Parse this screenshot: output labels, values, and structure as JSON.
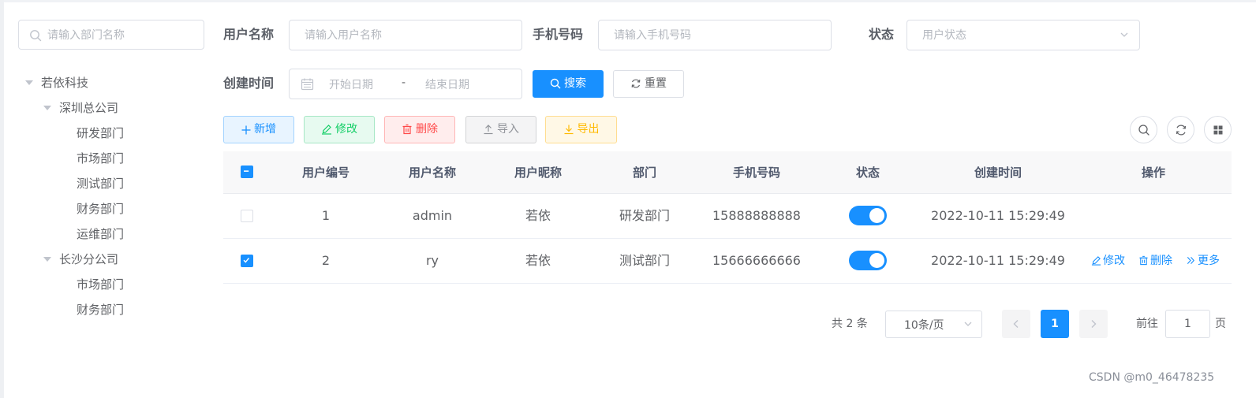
{
  "sidebar": {
    "search_placeholder": "请输入部门名称",
    "tree": [
      {
        "label": "若依科技",
        "level": 0
      },
      {
        "label": "深圳总公司",
        "level": 1
      },
      {
        "label": "研发部门",
        "level": 2
      },
      {
        "label": "市场部门",
        "level": 2
      },
      {
        "label": "测试部门",
        "level": 2
      },
      {
        "label": "财务部门",
        "level": 2
      },
      {
        "label": "运维部门",
        "level": 2
      },
      {
        "label": "长沙分公司",
        "level": 1
      },
      {
        "label": "市场部门",
        "level": 2
      },
      {
        "label": "财务部门",
        "level": 2
      }
    ]
  },
  "search_form": {
    "username_label": "用户名称",
    "username_placeholder": "请输入用户名称",
    "phone_label": "手机号码",
    "phone_placeholder": "请输入手机号码",
    "status_label": "状态",
    "status_placeholder": "用户状态",
    "created_label": "创建时间",
    "start_placeholder": "开始日期",
    "range_separator": "-",
    "end_placeholder": "结束日期",
    "search_button": "搜索",
    "reset_button": "重置"
  },
  "toolbar": {
    "add": "新增",
    "edit": "修改",
    "delete": "删除",
    "import": "导入",
    "export": "导出",
    "right_icons": [
      "search-icon",
      "refresh-icon",
      "columns-grid-icon"
    ]
  },
  "table": {
    "columns": [
      "用户编号",
      "用户名称",
      "用户昵称",
      "部门",
      "手机号码",
      "状态",
      "创建时间",
      "操作"
    ],
    "header_checkbox": "indeterminate",
    "rows": [
      {
        "selected": false,
        "id": "1",
        "username": "admin",
        "nickname": "若依",
        "dept": "研发部门",
        "phone": "15888888888",
        "status_on": true,
        "created": "2022-10-11 15:29:49",
        "actions": []
      },
      {
        "selected": true,
        "id": "2",
        "username": "ry",
        "nickname": "若依",
        "dept": "测试部门",
        "phone": "15666666666",
        "status_on": true,
        "created": "2022-10-11 15:29:49",
        "actions": [
          "修改",
          "删除",
          "更多"
        ]
      }
    ]
  },
  "pagination": {
    "total_text": "共 2 条",
    "page_size": "10条/页",
    "current_page": "1",
    "goto_label": "前往",
    "goto_value": "1",
    "page_suffix": "页"
  },
  "watermark": "CSDN @m0_46478235",
  "colors": {
    "primary": "#1890ff",
    "success": "#13ce66",
    "danger": "#ff4949",
    "warning": "#ffba00",
    "info": "#909399"
  }
}
